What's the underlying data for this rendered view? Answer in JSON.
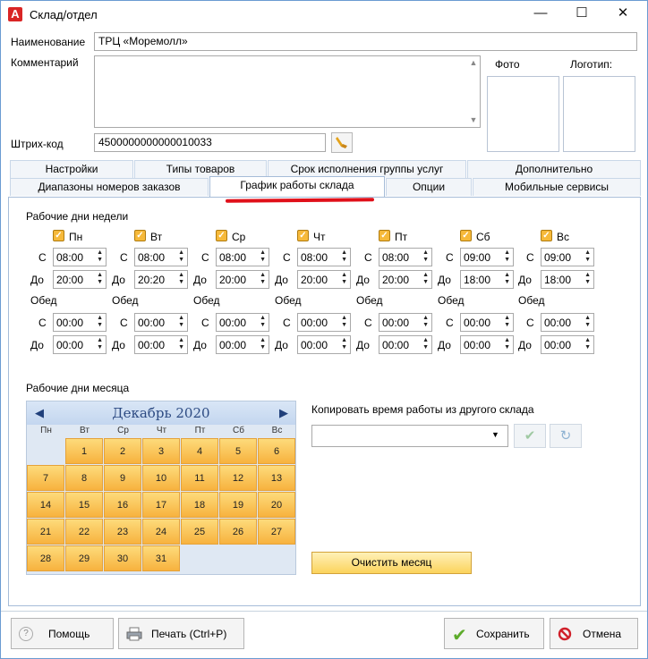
{
  "window": {
    "title": "Склад/отдел",
    "app_icon": "A"
  },
  "form": {
    "name_label": "Наименование",
    "name_value": "ТРЦ «Моремолл»",
    "comment_label": "Комментарий",
    "comment_value": "",
    "photo_label": "Фото",
    "logo_label": "Логотип:",
    "barcode_label": "Штрих-код",
    "barcode_value": "4500000000000010033"
  },
  "tabs_row1": [
    "Настройки",
    "Типы товаров",
    "Срок исполнения группы услуг",
    "Дополнительно"
  ],
  "tabs_row2": [
    "Диапазоны номеров заказов",
    "График работы склада",
    "Опции",
    "Мобильные сервисы"
  ],
  "week": {
    "title": "Рабочие дни недели",
    "from_label": "С",
    "to_label": "До",
    "lunch_label": "Обед",
    "days": [
      {
        "name": "Пн",
        "from": "08:00",
        "to": "20:00",
        "lunch_from": "00:00",
        "lunch_to": "00:00"
      },
      {
        "name": "Вт",
        "from": "08:00",
        "to": "20:20",
        "lunch_from": "00:00",
        "lunch_to": "00:00"
      },
      {
        "name": "Ср",
        "from": "08:00",
        "to": "20:00",
        "lunch_from": "00:00",
        "lunch_to": "00:00"
      },
      {
        "name": "Чт",
        "from": "08:00",
        "to": "20:00",
        "lunch_from": "00:00",
        "lunch_to": "00:00"
      },
      {
        "name": "Пт",
        "from": "08:00",
        "to": "20:00",
        "lunch_from": "00:00",
        "lunch_to": "00:00"
      },
      {
        "name": "Сб",
        "from": "09:00",
        "to": "18:00",
        "lunch_from": "00:00",
        "lunch_to": "00:00"
      },
      {
        "name": "Вс",
        "from": "09:00",
        "to": "18:00",
        "lunch_from": "00:00",
        "lunch_to": "00:00"
      }
    ]
  },
  "month": {
    "title": "Рабочие дни месяца",
    "calendar_title": "Декабрь 2020",
    "weekdays": [
      "Пн",
      "Вт",
      "Ср",
      "Чт",
      "Пт",
      "Сб",
      "Вс"
    ],
    "first_weekday_index": 1,
    "days": [
      "1",
      "2",
      "3",
      "4",
      "5",
      "6",
      "7",
      "8",
      "9",
      "10",
      "11",
      "12",
      "13",
      "14",
      "15",
      "16",
      "17",
      "18",
      "19",
      "20",
      "21",
      "22",
      "23",
      "24",
      "25",
      "26",
      "27",
      "28",
      "29",
      "30",
      "31"
    ]
  },
  "copy": {
    "label": "Копировать время работы из другого склада",
    "selected": "",
    "clear_month": "Очистить месяц"
  },
  "buttons": {
    "help": "Помощь",
    "print": "Печать (Ctrl+P)",
    "save": "Сохранить",
    "cancel": "Отмена"
  }
}
